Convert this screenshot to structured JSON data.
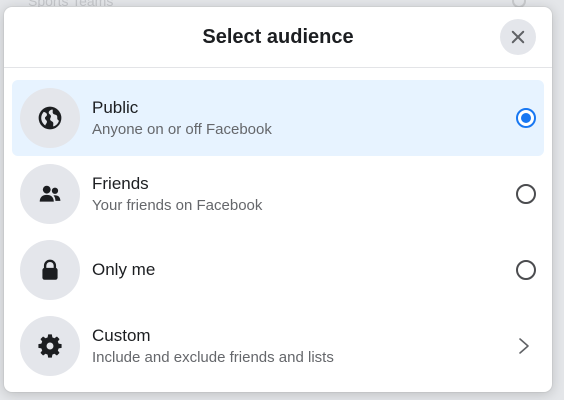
{
  "background": {
    "text": "Sports Teams"
  },
  "dialog": {
    "title": "Select audience",
    "close_icon": "close-icon"
  },
  "options": [
    {
      "label": "Public",
      "description": "Anyone on or off Facebook",
      "icon": "globe-icon",
      "selected": true,
      "control": "radio"
    },
    {
      "label": "Friends",
      "description": "Your friends on Facebook",
      "icon": "friends-icon",
      "selected": false,
      "control": "radio"
    },
    {
      "label": "Only me",
      "description": "",
      "icon": "lock-icon",
      "selected": false,
      "control": "radio"
    },
    {
      "label": "Custom",
      "description": "Include and exclude friends and lists",
      "icon": "gear-icon",
      "selected": false,
      "control": "chevron"
    }
  ],
  "colors": {
    "accent": "#1877f2",
    "selected_bg": "#e7f3ff",
    "icon_bg": "#e4e6eb",
    "text_primary": "#1c1e21",
    "text_secondary": "#65676b"
  }
}
